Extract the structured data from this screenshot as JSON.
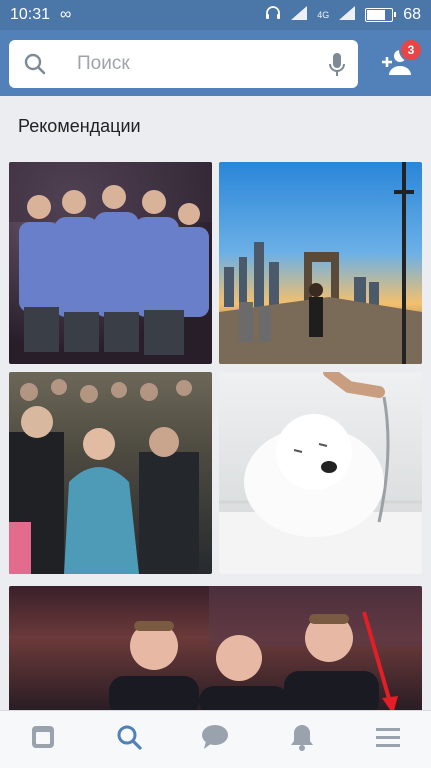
{
  "status_bar": {
    "time": "10:31",
    "signal_label": "4G",
    "battery_percent": "68"
  },
  "header": {
    "search_placeholder": "Поиск",
    "friend_requests_badge": "3"
  },
  "section": {
    "title": "Рекомендации"
  },
  "photos": [
    {
      "subject": "football team group hug"
    },
    {
      "subject": "brooklyn bridge walkway at sunset"
    },
    {
      "subject": "audience at ceremony"
    },
    {
      "subject": "white puppy in bathtub"
    },
    {
      "subject": "three friends portrait"
    }
  ],
  "bottom_nav": {
    "items": [
      "news-icon",
      "search-icon",
      "messages-icon",
      "notifications-icon",
      "menu-icon"
    ],
    "active": "search-icon"
  },
  "colors": {
    "header": "#5181b8",
    "status_bar": "#4a76a8",
    "badge": "#e64646",
    "active_nav": "#5181b8",
    "arrow": "#e41e26"
  }
}
